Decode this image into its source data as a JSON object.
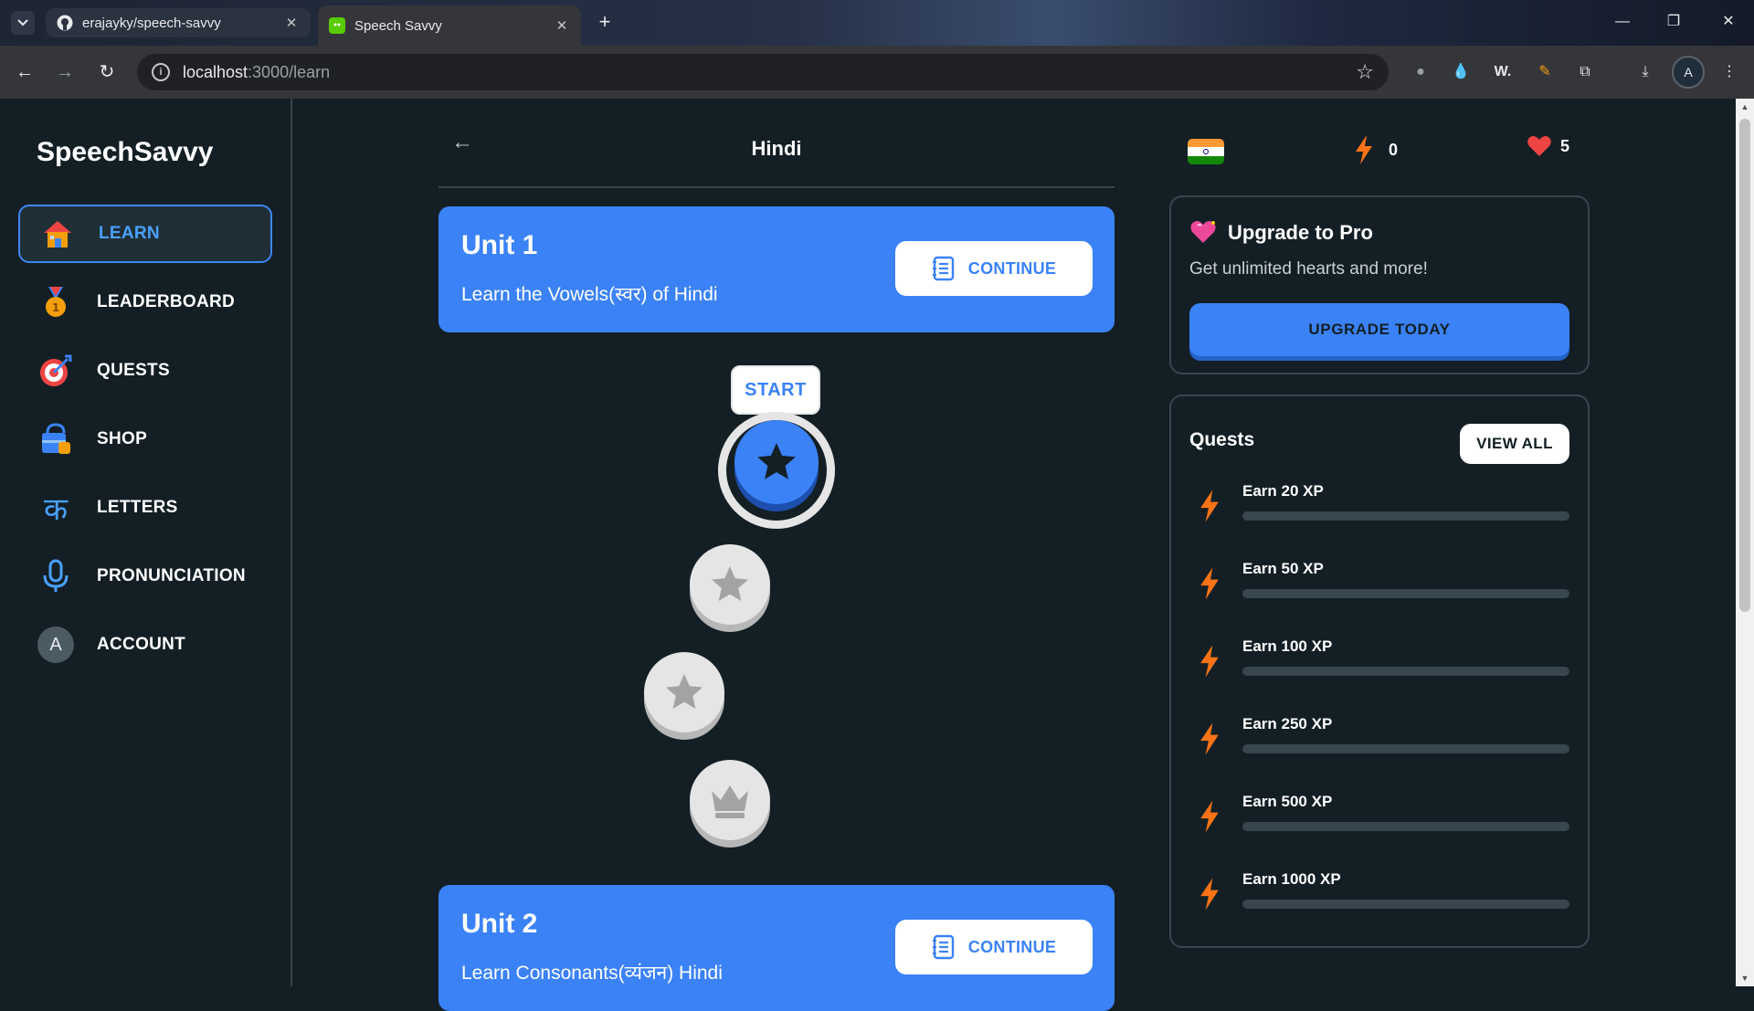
{
  "browser": {
    "tabs": [
      {
        "title": "erajayky/speech-savvy",
        "active": false
      },
      {
        "title": "Speech Savvy",
        "active": true
      }
    ],
    "url_host": "localhost",
    "url_path": ":3000/learn",
    "profile_initial": "A"
  },
  "sidebar": {
    "logo": "SpeechSavvy",
    "items": [
      {
        "label": "LEARN",
        "icon": "house-icon",
        "active": true
      },
      {
        "label": "LEADERBOARD",
        "icon": "medal-icon",
        "active": false
      },
      {
        "label": "QUESTS",
        "icon": "target-icon",
        "active": false
      },
      {
        "label": "SHOP",
        "icon": "shopping-bag-icon",
        "active": false
      },
      {
        "label": "LETTERS",
        "icon": "hindi-letter-icon",
        "active": false
      },
      {
        "label": "PRONUNCIATION",
        "icon": "microphone-icon",
        "active": false
      },
      {
        "label": "ACCOUNT",
        "icon": "account-avatar-icon",
        "active": false
      }
    ],
    "account_initial": "A",
    "letters_glyph": "क"
  },
  "header": {
    "language": "Hindi",
    "xp": "0",
    "hearts": "5"
  },
  "units": [
    {
      "title": "Unit 1",
      "description": "Learn the Vowels(स्वर) of Hindi",
      "button": "CONTINUE"
    },
    {
      "title": "Unit 2",
      "description": "Learn Consonants(व्यंजन) Hindi",
      "button": "CONTINUE"
    }
  ],
  "lesson_path": {
    "start_label": "START",
    "lessons": [
      {
        "state": "current",
        "icon": "star-icon"
      },
      {
        "state": "locked",
        "icon": "star-icon"
      },
      {
        "state": "locked",
        "icon": "star-icon"
      },
      {
        "state": "locked",
        "icon": "crown-icon"
      }
    ]
  },
  "promo": {
    "title": "Upgrade to Pro",
    "subtitle": "Get unlimited hearts and more!",
    "button": "UPGRADE TODAY"
  },
  "quests": {
    "title": "Quests",
    "view_all": "VIEW ALL",
    "items": [
      {
        "label": "Earn 20 XP",
        "progress": 0
      },
      {
        "label": "Earn 50 XP",
        "progress": 0
      },
      {
        "label": "Earn 100 XP",
        "progress": 0
      },
      {
        "label": "Earn 250 XP",
        "progress": 0
      },
      {
        "label": "Earn 500 XP",
        "progress": 0
      },
      {
        "label": "Earn 1000 XP",
        "progress": 0
      }
    ]
  },
  "colors": {
    "background": "#131f24",
    "accent_blue": "#3b82f6",
    "border": "#37464f",
    "bolt_orange": "#f97316",
    "heart_red": "#ef4444"
  }
}
